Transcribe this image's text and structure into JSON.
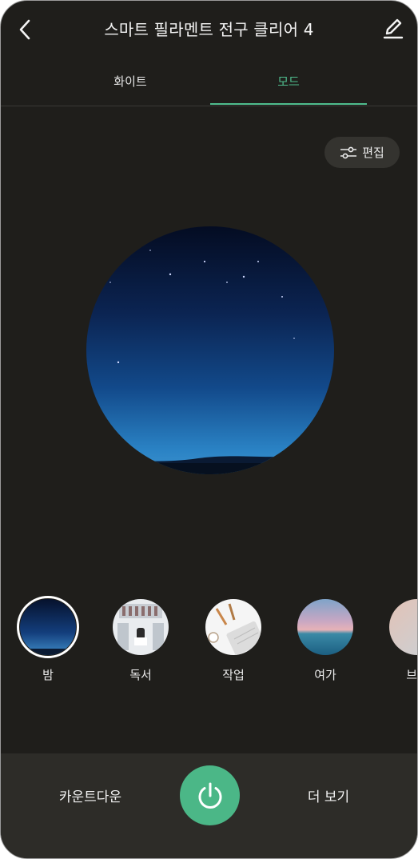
{
  "header": {
    "title": "스마트 필라멘트 전구 클리어 4",
    "back_icon": "chevron-left-icon",
    "edit_icon": "pencil-icon"
  },
  "tabs": [
    {
      "label": "화이트",
      "active": false
    },
    {
      "label": "모드",
      "active": true
    }
  ],
  "colors": {
    "accent": "#4fbd8e",
    "background": "#1f1e1b",
    "footer": "#2d2c28",
    "power_button": "#4bb787"
  },
  "edit_chip": {
    "label": "편집",
    "icon": "sliders-icon"
  },
  "scenes": [
    {
      "label": "밤",
      "selected": true
    },
    {
      "label": "독서",
      "selected": false
    },
    {
      "label": "작업",
      "selected": false
    },
    {
      "label": "여가",
      "selected": false
    },
    {
      "label": "브리",
      "selected": false
    }
  ],
  "footer": {
    "countdown_label": "카운트다운",
    "power_icon": "power-icon",
    "more_label": "더 보기"
  }
}
